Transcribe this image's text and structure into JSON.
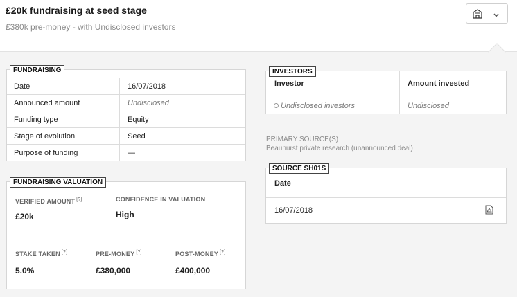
{
  "header": {
    "title": "£20k fundraising at seed stage",
    "subtitle": "£380k pre-money - with Undisclosed investors",
    "menu_icon": "building-icon",
    "dropdown_icon": "chevron-down-icon"
  },
  "fundraising": {
    "tag": "FUNDRAISING",
    "rows": [
      {
        "label": "Date",
        "value": "16/07/2018"
      },
      {
        "label": "Announced amount",
        "value": "Undisclosed"
      },
      {
        "label": "Funding type",
        "value": "Equity"
      },
      {
        "label": "Stage of evolution",
        "value": "Seed"
      },
      {
        "label": "Purpose of funding",
        "value": "—"
      }
    ]
  },
  "valuation": {
    "tag": "FUNDRAISING VALUATION",
    "verified_amount_label": "VERIFIED AMOUNT",
    "verified_amount": "£20k",
    "confidence_label": "CONFIDENCE IN VALUATION",
    "confidence": "High",
    "stake_label": "STAKE TAKEN",
    "stake": "5.0%",
    "pre_money_label": "PRE-MONEY",
    "pre_money": "£380,000",
    "post_money_label": "POST-MONEY",
    "post_money": "£400,000",
    "help_marker": "[?]"
  },
  "investors": {
    "tag": "INVESTORS",
    "col_investor": "Investor",
    "col_amount": "Amount invested",
    "rows": [
      {
        "investor": "Undisclosed investors",
        "amount": "Undisclosed"
      }
    ]
  },
  "primary_source": {
    "label": "PRIMARY SOURCE(S)",
    "text": "Beauhurst private research (unannounced deal)"
  },
  "source": {
    "tag": "SOURCE SH01S",
    "col_date": "Date",
    "date": "16/07/2018",
    "doc_icon": "pdf-document-icon"
  }
}
